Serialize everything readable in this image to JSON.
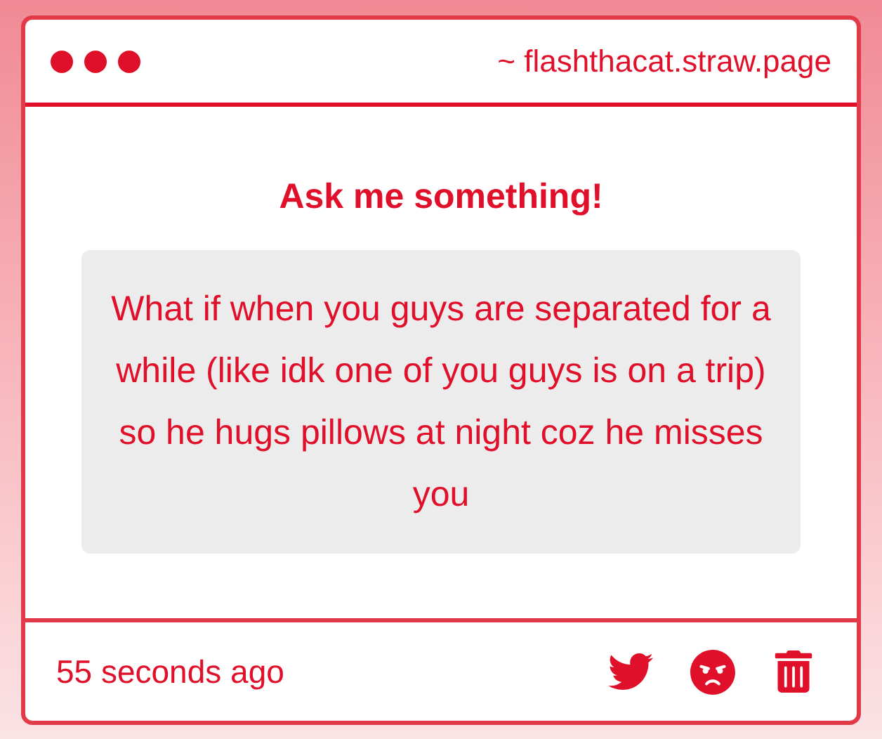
{
  "window": {
    "url": "~ flashthacat.straw.page"
  },
  "title": "Ask me something!",
  "question": "What if when you guys are separated for a while (like idk one of you guys is on a trip) so he hugs pillows at night coz he misses you",
  "footer": {
    "time": "55 seconds ago"
  }
}
